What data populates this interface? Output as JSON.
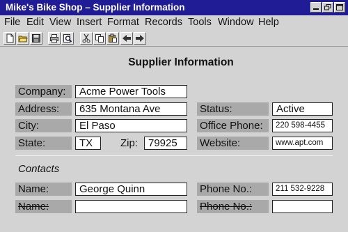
{
  "window": {
    "title": "Mike's Bike Shop – Supplier Information"
  },
  "menu": [
    "File",
    "Edit",
    "View",
    "Insert",
    "Format",
    "Records",
    "Tools",
    "Window",
    "Help"
  ],
  "toolbar_icons": [
    "new-document-icon",
    "open-folder-icon",
    "save-icon",
    "print-icon",
    "print-preview-icon",
    "cut-icon",
    "copy-icon",
    "paste-icon",
    "previous-record-icon",
    "next-record-icon"
  ],
  "form": {
    "title": "Supplier Information",
    "company": {
      "label": "Company:",
      "value": "Acme Power Tools"
    },
    "address": {
      "label": "Address:",
      "value": "635 Montana Ave"
    },
    "status": {
      "label": "Status:",
      "value": "Active"
    },
    "city": {
      "label": "City:",
      "value": "El Paso"
    },
    "office_phone": {
      "label": "Office Phone:",
      "value": "220 598-4455"
    },
    "state": {
      "label": "State:",
      "value": "TX"
    },
    "zip": {
      "label": "Zip:",
      "value": "79925"
    },
    "website": {
      "label": "Website:",
      "value": "www.apt.com"
    },
    "contacts_heading": "Contacts",
    "contact1": {
      "name_label": "Name:",
      "name_value": "George Quinn",
      "phone_label": "Phone No.:",
      "phone_value": "211 532-9228"
    },
    "contact2": {
      "name_label": "Name:",
      "name_value": "",
      "phone_label": "Phone No.:",
      "phone_value": ""
    }
  },
  "colors": {
    "title_bar": "#1f1c96",
    "window_bg": "#d3d3d3",
    "label_bg": "#a9a9a9"
  }
}
